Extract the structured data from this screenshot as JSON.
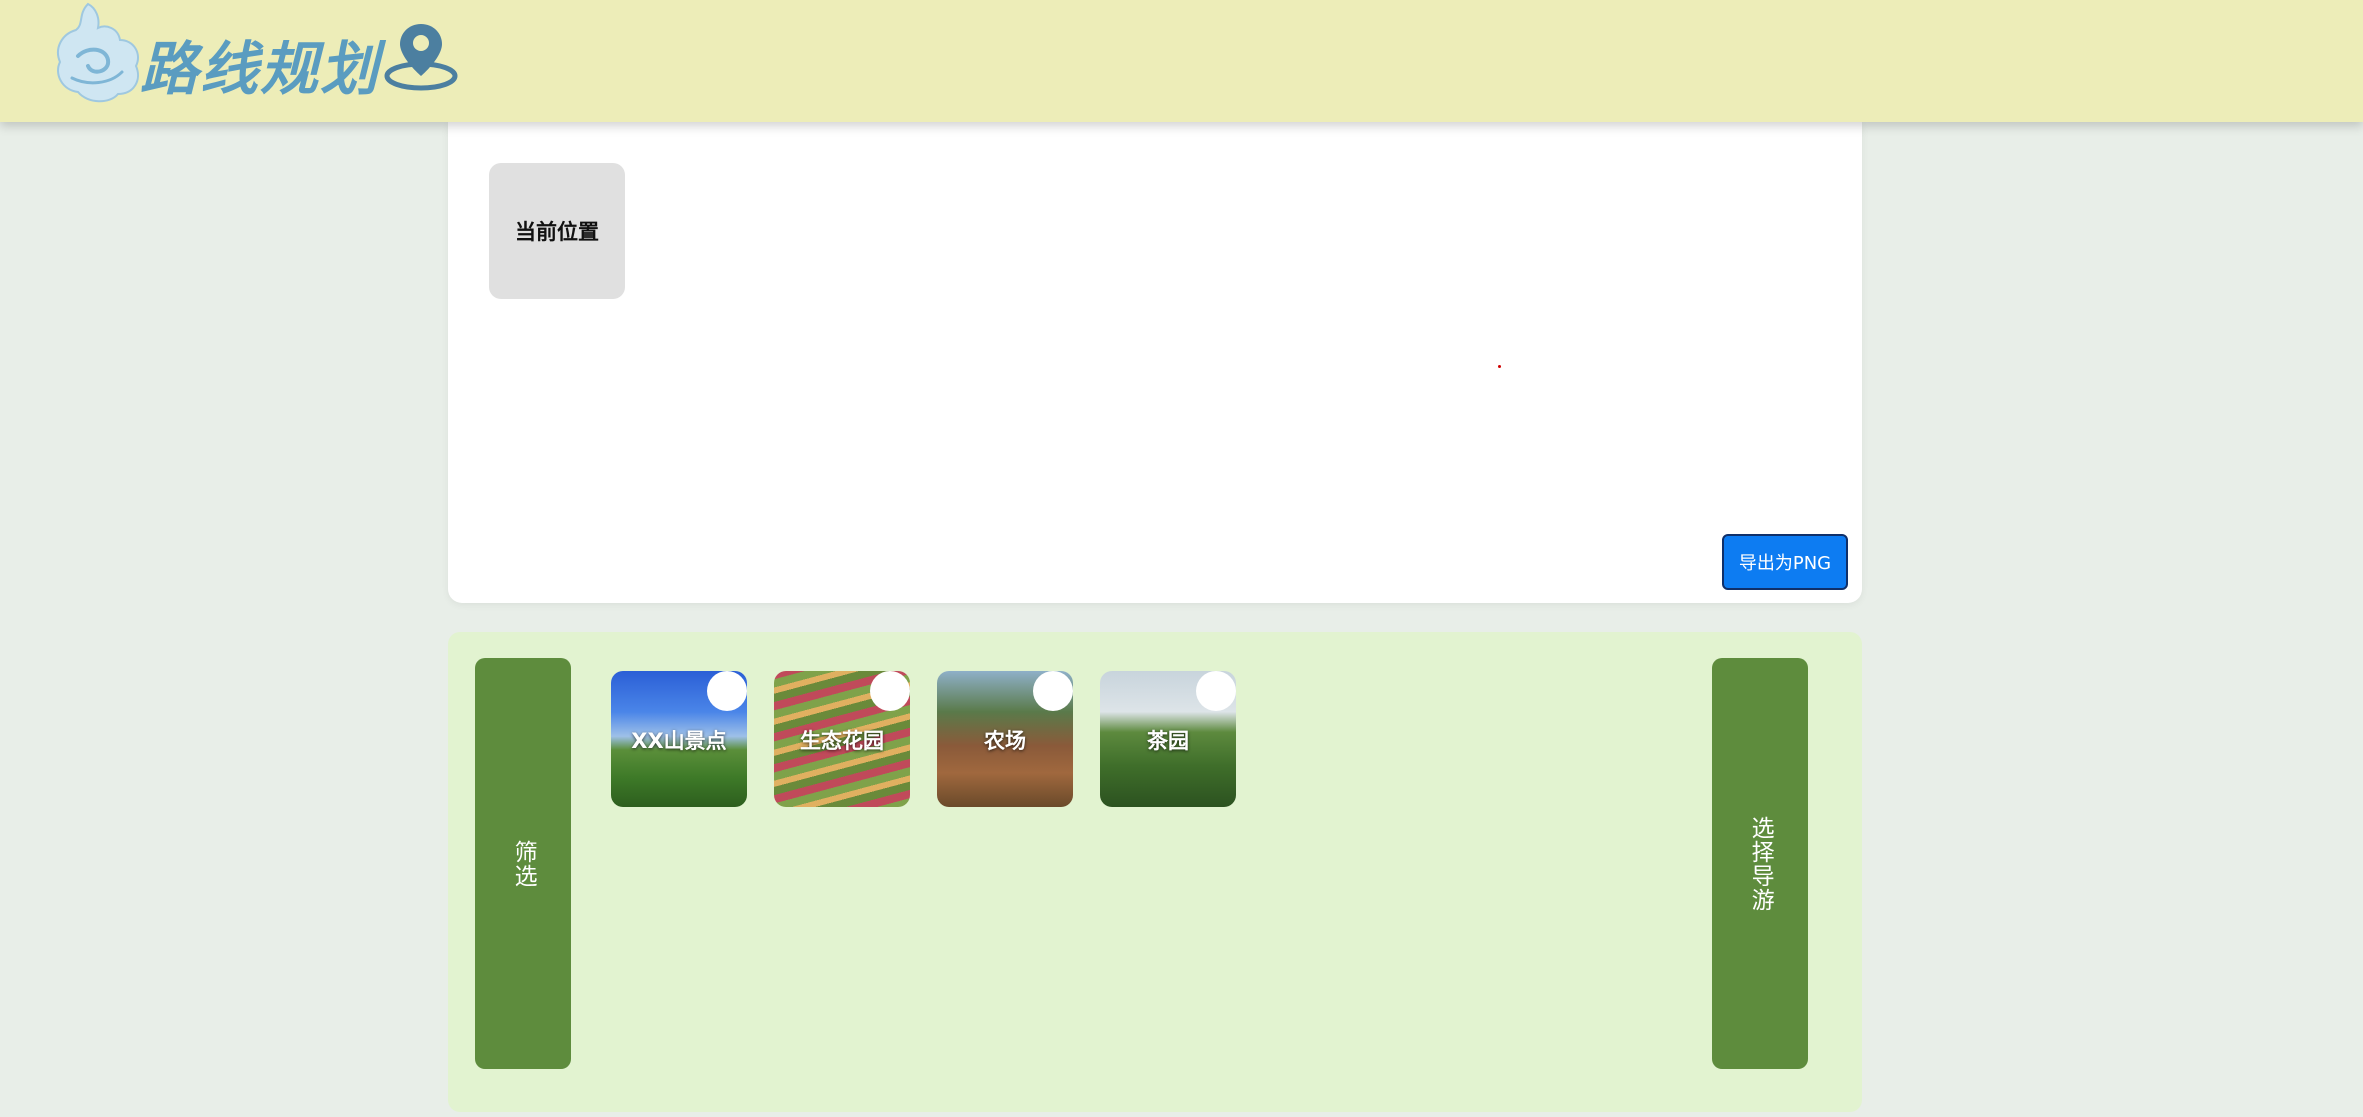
{
  "header": {
    "title": "路线规划",
    "bg_color": "#ededb8",
    "logo_icon": "cloud-logo-icon",
    "pin_icon": "map-pin-icon"
  },
  "map": {
    "current_location_label": "当前位置",
    "export_label": "导出为PNG"
  },
  "panel": {
    "filter_label": "筛选",
    "guide_label": "选择导游",
    "spots": [
      {
        "name": "XX山景点"
      },
      {
        "name": "生态花园"
      },
      {
        "name": "农场"
      },
      {
        "name": "茶园"
      }
    ]
  },
  "colors": {
    "accent_green": "#5e8c3d",
    "panel_bg": "#e2f3d0",
    "export_blue": "#0d7cf2",
    "title_blue": "#5a9cc0"
  }
}
